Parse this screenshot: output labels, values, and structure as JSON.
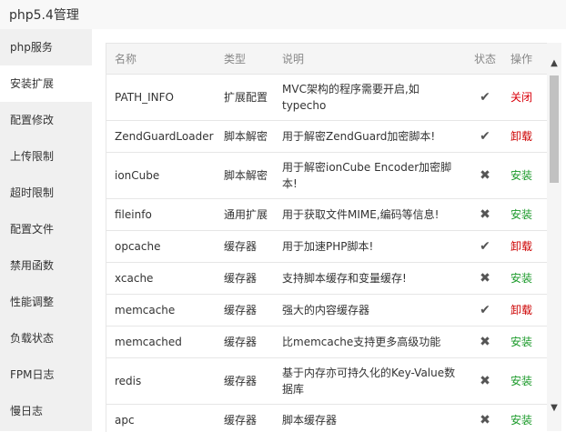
{
  "app": {
    "title": "php5.4管理"
  },
  "sidebar": {
    "items": [
      {
        "label": "php服务",
        "active": false
      },
      {
        "label": "安装扩展",
        "active": true
      },
      {
        "label": "配置修改",
        "active": false
      },
      {
        "label": "上传限制",
        "active": false
      },
      {
        "label": "超时限制",
        "active": false
      },
      {
        "label": "配置文件",
        "active": false
      },
      {
        "label": "禁用函数",
        "active": false
      },
      {
        "label": "性能调整",
        "active": false
      },
      {
        "label": "负载状态",
        "active": false
      },
      {
        "label": "FPM日志",
        "active": false
      },
      {
        "label": "慢日志",
        "active": false
      }
    ]
  },
  "table": {
    "headers": {
      "name": "名称",
      "type": "类型",
      "desc": "说明",
      "state": "状态",
      "op": "操作"
    },
    "rows": [
      {
        "name": "PATH_INFO",
        "type": "扩展配置",
        "desc": "MVC架构的程序需要开启,如typecho",
        "state": "✔",
        "op": "关闭",
        "op_kind": "close"
      },
      {
        "name": "ZendGuardLoader",
        "type": "脚本解密",
        "desc": "用于解密ZendGuard加密脚本!",
        "state": "✔",
        "op": "卸载",
        "op_kind": "uninstall"
      },
      {
        "name": "ionCube",
        "type": "脚本解密",
        "desc": "用于解密ionCube Encoder加密脚本!",
        "state": "✖",
        "op": "安装",
        "op_kind": "install"
      },
      {
        "name": "fileinfo",
        "type": "通用扩展",
        "desc": "用于获取文件MIME,编码等信息!",
        "state": "✖",
        "op": "安装",
        "op_kind": "install"
      },
      {
        "name": "opcache",
        "type": "缓存器",
        "desc": "用于加速PHP脚本!",
        "state": "✔",
        "op": "卸载",
        "op_kind": "uninstall"
      },
      {
        "name": "xcache",
        "type": "缓存器",
        "desc": "支持脚本缓存和变量缓存!",
        "state": "✖",
        "op": "安装",
        "op_kind": "install"
      },
      {
        "name": "memcache",
        "type": "缓存器",
        "desc": "强大的内容缓存器",
        "state": "✔",
        "op": "卸载",
        "op_kind": "uninstall"
      },
      {
        "name": "memcached",
        "type": "缓存器",
        "desc": "比memcache支持更多高级功能",
        "state": "✖",
        "op": "安装",
        "op_kind": "install"
      },
      {
        "name": "redis",
        "type": "缓存器",
        "desc": "基于内存亦可持久化的Key-Value数据库",
        "state": "✖",
        "op": "安装",
        "op_kind": "install"
      },
      {
        "name": "apc",
        "type": "缓存器",
        "desc": "脚本缓存器",
        "state": "✖",
        "op": "安装",
        "op_kind": "install"
      }
    ]
  },
  "scroll": {
    "up_icon": "chevron-up-icon",
    "down_icon": "chevron-down-icon"
  }
}
